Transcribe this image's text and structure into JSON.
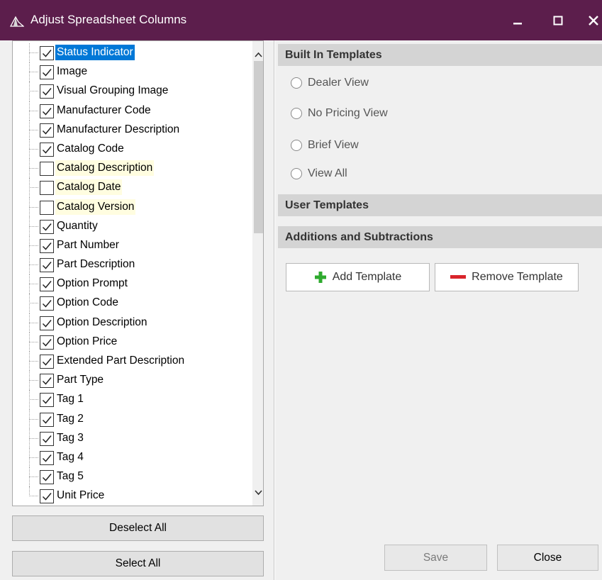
{
  "window": {
    "title": "Adjust Spreadsheet Columns",
    "icon": "app-logo-icon",
    "controls": {
      "minimize": "–",
      "maximize": "☐",
      "close": "✕"
    }
  },
  "columns": [
    {
      "label": "Status Indicator",
      "checked": true,
      "state": "selected"
    },
    {
      "label": "Image",
      "checked": true,
      "state": ""
    },
    {
      "label": "Visual Grouping Image",
      "checked": true,
      "state": ""
    },
    {
      "label": "Manufacturer Code",
      "checked": true,
      "state": ""
    },
    {
      "label": "Manufacturer Description",
      "checked": true,
      "state": ""
    },
    {
      "label": "Catalog Code",
      "checked": true,
      "state": ""
    },
    {
      "label": "Catalog Description",
      "checked": false,
      "state": "highlight"
    },
    {
      "label": "Catalog Date",
      "checked": false,
      "state": "highlight"
    },
    {
      "label": "Catalog Version",
      "checked": false,
      "state": "highlight"
    },
    {
      "label": "Quantity",
      "checked": true,
      "state": ""
    },
    {
      "label": "Part Number",
      "checked": true,
      "state": ""
    },
    {
      "label": "Part Description",
      "checked": true,
      "state": ""
    },
    {
      "label": "Option Prompt",
      "checked": true,
      "state": ""
    },
    {
      "label": "Option Code",
      "checked": true,
      "state": ""
    },
    {
      "label": "Option Description",
      "checked": true,
      "state": ""
    },
    {
      "label": "Option Price",
      "checked": true,
      "state": ""
    },
    {
      "label": "Extended Part Description",
      "checked": true,
      "state": ""
    },
    {
      "label": "Part Type",
      "checked": true,
      "state": ""
    },
    {
      "label": "Tag 1",
      "checked": true,
      "state": ""
    },
    {
      "label": "Tag 2",
      "checked": true,
      "state": ""
    },
    {
      "label": "Tag 3",
      "checked": true,
      "state": ""
    },
    {
      "label": "Tag 4",
      "checked": true,
      "state": ""
    },
    {
      "label": "Tag 5",
      "checked": true,
      "state": ""
    },
    {
      "label": "Unit Price",
      "checked": true,
      "state": ""
    }
  ],
  "left_buttons": {
    "deselect_all": "Deselect All",
    "select_all": "Select All"
  },
  "built_in": {
    "header": "Built In Templates",
    "options": [
      "Dealer View",
      "No Pricing View",
      "Brief View",
      "View All"
    ]
  },
  "user_templates": {
    "header": "User Templates"
  },
  "additions": {
    "header": "Additions and Subtractions",
    "add_label": "Add Template",
    "remove_label": "Remove Template"
  },
  "footer": {
    "save_label": "Save",
    "close_label": "Close"
  },
  "colors": {
    "titlebar": "#5c1e4c",
    "selection": "#0078d7",
    "highlight": "#fffde0",
    "add_icon": "#2eaa2e",
    "remove_icon": "#d9242b"
  }
}
